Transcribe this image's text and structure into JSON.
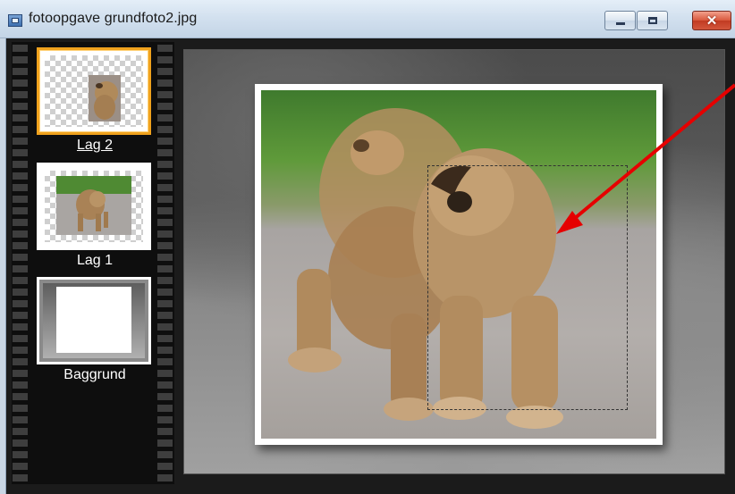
{
  "window": {
    "title": "fotoopgave grundfoto2.jpg",
    "buttons": {
      "minimize": "minimize-icon",
      "maximize": "maximize-icon",
      "close": "close-icon"
    }
  },
  "layers": [
    {
      "label": "Lag 2",
      "selected": true
    },
    {
      "label": "Lag 1",
      "selected": false
    },
    {
      "label": "Baggrund",
      "selected": false
    }
  ],
  "colors": {
    "selection_accent": "#f0a21d",
    "annotation_arrow": "#e60000",
    "close_button": "#c23b22"
  }
}
